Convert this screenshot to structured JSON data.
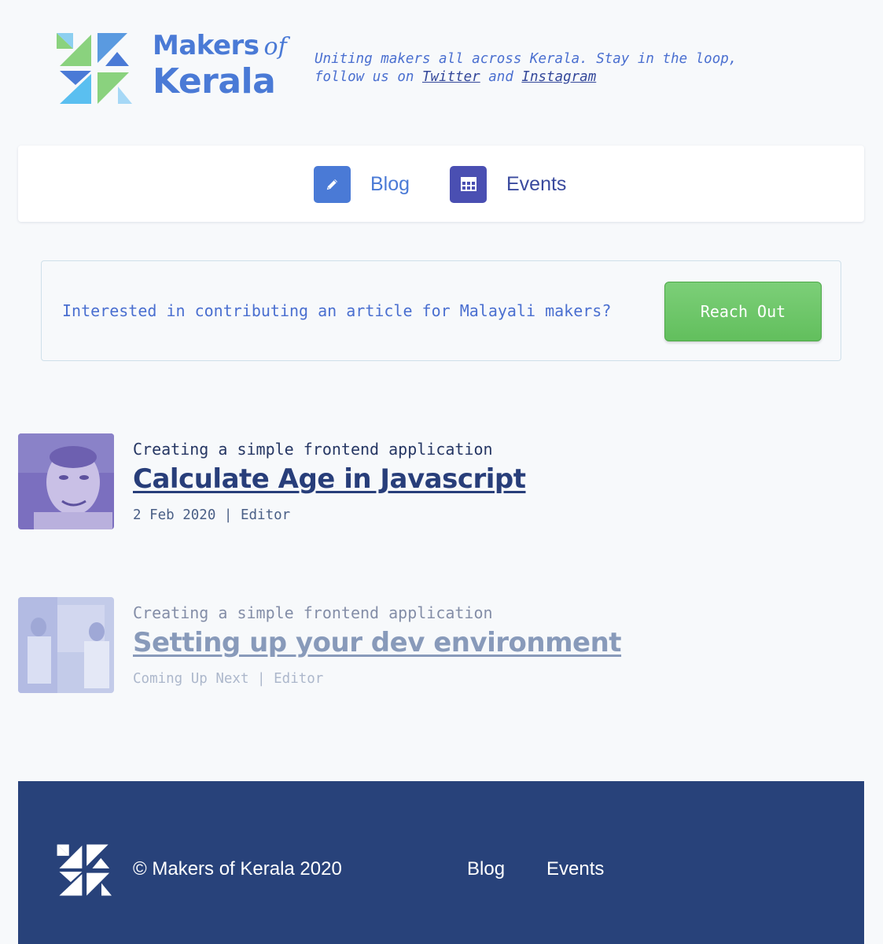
{
  "brand": {
    "makers": "Makers",
    "of": "of",
    "kerala": "Kerala"
  },
  "tagline": {
    "line1": "Uniting makers all across Kerala. Stay in the loop,",
    "line2_prefix": "follow us on ",
    "twitter": "Twitter",
    "and": " and ",
    "instagram": "Instagram"
  },
  "nav": {
    "blog": {
      "label": "Blog",
      "icon": "pencil-icon"
    },
    "events": {
      "label": "Events",
      "icon": "calendar-icon"
    }
  },
  "cta": {
    "text": "Interested in contributing an article for Malayali makers?",
    "button": "Reach Out"
  },
  "posts": [
    {
      "series": "Creating a simple frontend application",
      "title": "Calculate Age in Javascript",
      "date": "2 Feb 2020",
      "author": "Editor"
    },
    {
      "series": "Creating a simple frontend application",
      "title": "Setting up your dev environment",
      "date": "Coming Up Next",
      "author": "Editor"
    }
  ],
  "footer": {
    "copyright": "© Makers of Kerala 2020",
    "links": [
      "Blog",
      "Events"
    ]
  },
  "colors": {
    "accent": "#4a7ad6",
    "events_accent": "#4a4fb2",
    "cta_green": "#6cc567",
    "footer_bg": "#28427a",
    "page_bg": "#f7f9fb"
  }
}
